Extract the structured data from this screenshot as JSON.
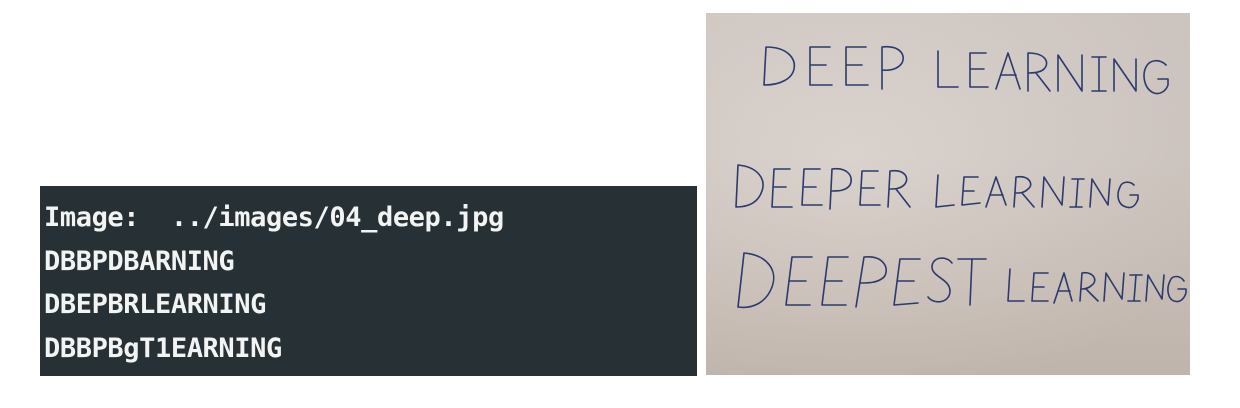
{
  "terminal": {
    "lines": [
      "Image:  ../images/04_deep.jpg",
      "DBBPDBARNING",
      "DBEPBRLEARNING",
      "DBBPBgT1EARNING"
    ]
  },
  "photo": {
    "handwritten_lines": [
      "DEEP LEARNING",
      "DEEPER LEARNING",
      "DEEPEST LEARNING"
    ],
    "ink_color": "#2c3a6e",
    "paper_color": "#d5ccc6"
  }
}
